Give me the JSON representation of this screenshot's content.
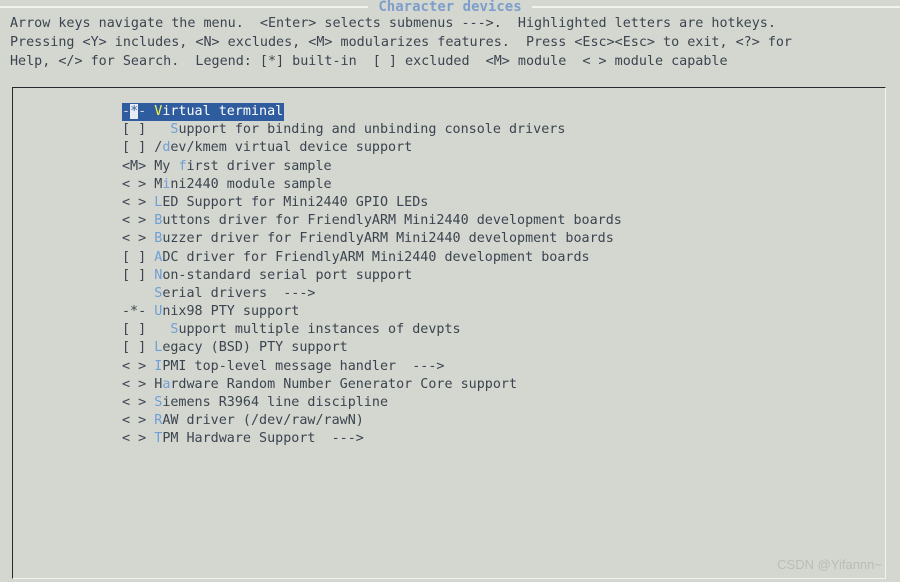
{
  "window": {
    "title": "Character devices"
  },
  "help": {
    "lines": [
      "Arrow keys navigate the menu.  <Enter> selects submenus --->.  Highlighted letters are hotkeys.",
      "Pressing <Y> includes, <N> excludes, <M> modularizes features.  Press <Esc><Esc> to exit, <?> for",
      "Help, </> for Search.  Legend: [*] built-in  [ ] excluded  <M> module  < > module capable"
    ]
  },
  "menu": {
    "items": [
      {
        "marker": "-*-",
        "indent": "",
        "pre": "",
        "hotkey": "V",
        "post": "irtual terminal",
        "submenu": "",
        "selected": true
      },
      {
        "marker": "[ ]",
        "indent": "  ",
        "pre": "",
        "hotkey": "S",
        "post": "upport for binding and unbinding console drivers",
        "submenu": "",
        "selected": false
      },
      {
        "marker": "[ ]",
        "indent": "",
        "pre": "/",
        "hotkey": "d",
        "post": "ev/kmem virtual device support",
        "submenu": "",
        "selected": false
      },
      {
        "marker": "<M>",
        "indent": "",
        "pre": "My ",
        "hotkey": "f",
        "post": "irst driver sample",
        "submenu": "",
        "selected": false
      },
      {
        "marker": "< >",
        "indent": "",
        "pre": "M",
        "hotkey": "i",
        "post": "ni2440 module sample",
        "submenu": "",
        "selected": false
      },
      {
        "marker": "< >",
        "indent": "",
        "pre": "",
        "hotkey": "L",
        "post": "ED Support for Mini2440 GPIO LEDs",
        "submenu": "",
        "selected": false
      },
      {
        "marker": "< >",
        "indent": "",
        "pre": "",
        "hotkey": "B",
        "post": "uttons driver for FriendlyARM Mini2440 development boards",
        "submenu": "",
        "selected": false
      },
      {
        "marker": "< >",
        "indent": "",
        "pre": "",
        "hotkey": "B",
        "post": "uzzer driver for FriendlyARM Mini2440 development boards",
        "submenu": "",
        "selected": false
      },
      {
        "marker": "[ ]",
        "indent": "",
        "pre": "",
        "hotkey": "A",
        "post": "DC driver for FriendlyARM Mini2440 development boards",
        "submenu": "",
        "selected": false
      },
      {
        "marker": "[ ]",
        "indent": "",
        "pre": "",
        "hotkey": "N",
        "post": "on-standard serial port support",
        "submenu": "",
        "selected": false
      },
      {
        "marker": "   ",
        "indent": "",
        "pre": "",
        "hotkey": "S",
        "post": "erial drivers",
        "submenu": "  --->",
        "selected": false
      },
      {
        "marker": "-*-",
        "indent": "",
        "pre": "",
        "hotkey": "U",
        "post": "nix98 PTY support",
        "submenu": "",
        "selected": false
      },
      {
        "marker": "[ ]",
        "indent": "  ",
        "pre": "",
        "hotkey": "S",
        "post": "upport multiple instances of devpts",
        "submenu": "",
        "selected": false
      },
      {
        "marker": "[ ]",
        "indent": "",
        "pre": "",
        "hotkey": "L",
        "post": "egacy (BSD) PTY support",
        "submenu": "",
        "selected": false
      },
      {
        "marker": "< >",
        "indent": "",
        "pre": "",
        "hotkey": "I",
        "post": "PMI top-level message handler",
        "submenu": "  --->",
        "selected": false
      },
      {
        "marker": "< >",
        "indent": "",
        "pre": "H",
        "hotkey": "a",
        "post": "rdware Random Number Generator Core support",
        "submenu": "",
        "selected": false
      },
      {
        "marker": "< >",
        "indent": "",
        "pre": "",
        "hotkey": "S",
        "post": "iemens R3964 line discipline",
        "submenu": "",
        "selected": false
      },
      {
        "marker": "< >",
        "indent": "",
        "pre": "",
        "hotkey": "R",
        "post": "AW driver (/dev/raw/rawN)",
        "submenu": "",
        "selected": false
      },
      {
        "marker": "< >",
        "indent": "",
        "pre": "",
        "hotkey": "T",
        "post": "PM Hardware Support",
        "submenu": "  --->",
        "selected": false
      }
    ]
  },
  "watermark": {
    "text": "CSDN @Yifannn~"
  },
  "colors": {
    "background": "#d4d7cf",
    "text": "#3b4450",
    "hotkey": "#6f9fd8",
    "title": "#7d9ecb",
    "selected_background": "#2f5c9e",
    "selected_text": "#ffffff",
    "selected_hotkey": "#f2f24d",
    "rule": "#f2f3ef",
    "watermark": "#b9bdb6"
  }
}
